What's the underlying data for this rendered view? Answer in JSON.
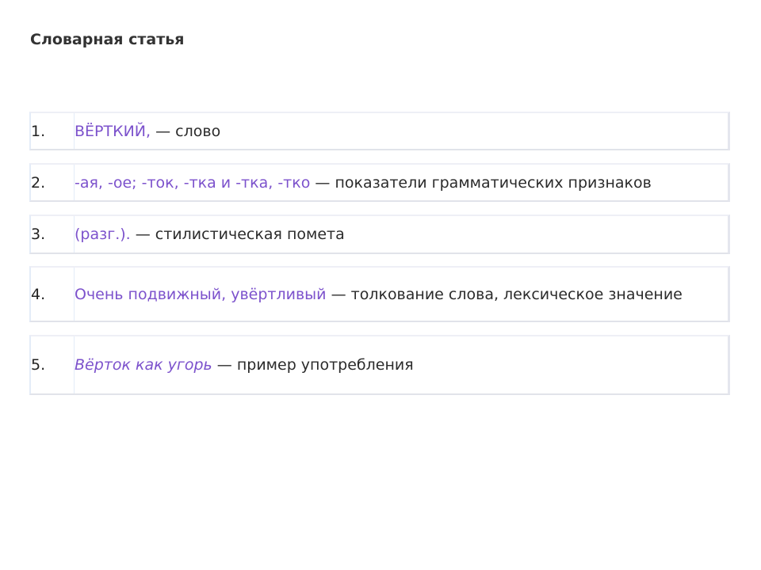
{
  "page": {
    "title": "Словарная статья"
  },
  "colors": {
    "accent": "#7c52cc",
    "text": "#2b2b2b",
    "border": "#e1e3ea"
  },
  "entries": [
    {
      "number": "1.",
      "term": "ВЁРТКИЙ,",
      "separator": " — ",
      "description": "слово"
    },
    {
      "number": "2.",
      "term": "-ая, -ое; -ток, -тка и -тка, -тко",
      "separator": " — ",
      "description": "показатели грамматических признаков"
    },
    {
      "number": "3.",
      "term": "(разг.).",
      "separator": " — ",
      "description": "стилистическая помета"
    },
    {
      "number": "4.",
      "term": "Очень подвижный, увёртливый",
      "separator": " — ",
      "description": "толкование слова, лексическое значение"
    },
    {
      "number": "5.",
      "term": "Вёрток как угорь",
      "separator": " — ",
      "description": "пример употребления"
    }
  ]
}
